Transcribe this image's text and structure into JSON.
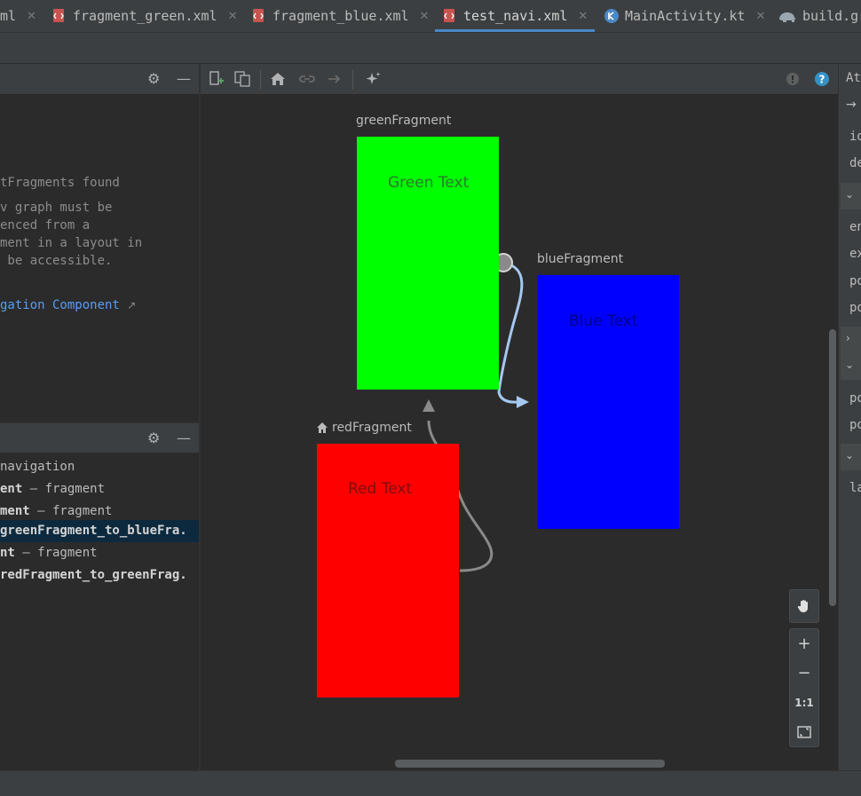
{
  "tabs": [
    {
      "label": "ml",
      "active": false
    },
    {
      "label": "fragment_green.xml",
      "active": false
    },
    {
      "label": "fragment_blue.xml",
      "active": false
    },
    {
      "label": "test_navi.xml",
      "active": true
    },
    {
      "label": "MainActivity.kt",
      "active": false
    },
    {
      "label": "build.gr",
      "active": false
    }
  ],
  "left_top": {
    "message_title": "tFragments found",
    "message_lines": [
      "v graph must be",
      "enced from a",
      "ment in a layout in",
      " be accessible."
    ],
    "link_text": "gation Component",
    "link_arrow": "↗"
  },
  "left_bottom": {
    "tree": [
      {
        "bold": "",
        "rest": "navigation"
      },
      {
        "bold": "ent",
        "rest": " – fragment"
      },
      {
        "bold": "ment",
        "rest": " – fragment"
      },
      {
        "bold": "greenFragment_to_blueFra.",
        "rest": "",
        "selected": true
      },
      {
        "bold": "nt",
        "rest": " – fragment"
      },
      {
        "bold": "redFragment_to_greenFrag.",
        "rest": ""
      }
    ]
  },
  "nav_graph": {
    "fragments": [
      {
        "id": "greenFragment",
        "label": "greenFragment",
        "text": "Green Text",
        "color": "#00ff00"
      },
      {
        "id": "blueFragment",
        "label": "blueFragment",
        "text": "Blue Text",
        "color": "#0000ff"
      },
      {
        "id": "redFragment",
        "label": "redFragment",
        "text": "Red Text",
        "color": "#ff0000",
        "start_destination": true
      }
    ],
    "action_colors": {
      "selected": "#a4c8f0",
      "normal": "#8a8a8a"
    }
  },
  "right_panel": {
    "title": "Att",
    "rows": [
      "id",
      "de",
      "en",
      "ex",
      "po",
      "po",
      "po",
      "po",
      "la"
    ],
    "arrow": "→"
  },
  "zoom": {
    "one_to_one": "1:1",
    "plus": "+",
    "minus": "−"
  },
  "colors": {
    "accent": "#4a88c7",
    "link": "#589df6",
    "help": "#3592c4"
  }
}
